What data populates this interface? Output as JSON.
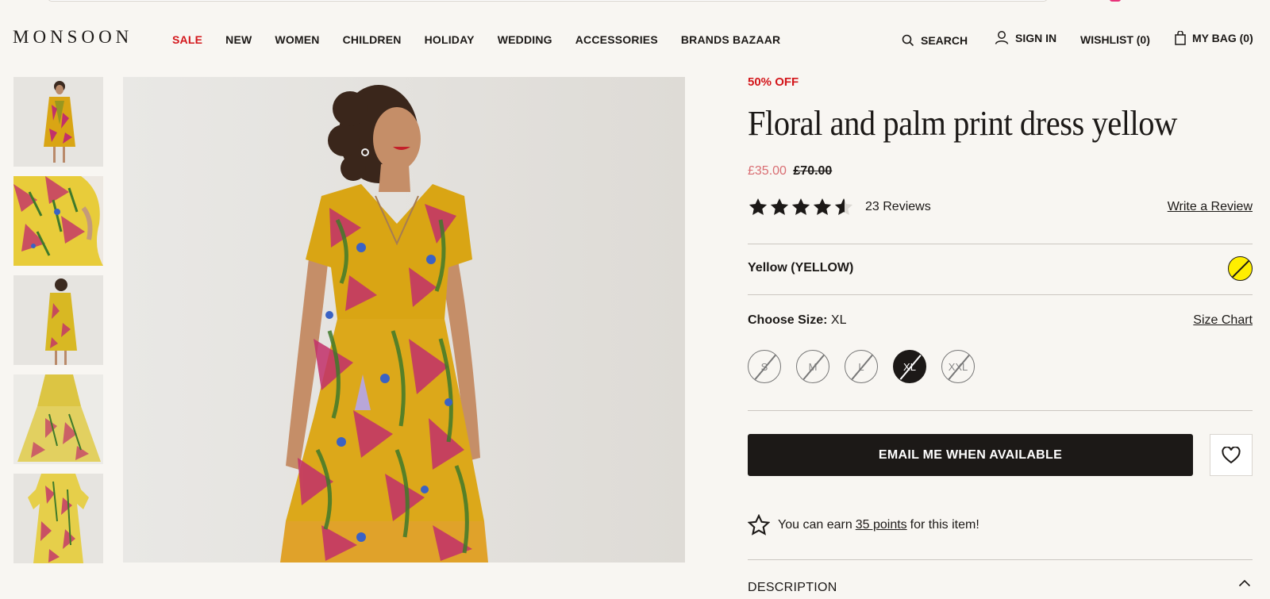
{
  "header": {
    "logo": "MONSOON",
    "nav": [
      "SALE",
      "NEW",
      "WOMEN",
      "CHILDREN",
      "HOLIDAY",
      "WEDDING",
      "ACCESSORIES",
      "BRANDS BAZAAR"
    ],
    "search_label": "SEARCH",
    "signin_label": "SIGN IN",
    "wishlist_label": "WISHLIST (0)",
    "bag_label": "MY BAG (0)"
  },
  "product": {
    "badge": "50% OFF",
    "title": "Floral and palm print dress yellow",
    "price_now": "£35.00",
    "price_was": "£70.00",
    "rating": 4.5,
    "reviews_count": "23 Reviews",
    "write_review": "Write a Review",
    "colour": "Yellow (YELLOW)",
    "size_label": "Choose Size:",
    "size_selected": "XL",
    "size_chart": "Size Chart",
    "sizes": [
      "S",
      "M",
      "L",
      "XL",
      "XXL"
    ],
    "email_button": "EMAIL ME WHEN AVAILABLE",
    "points_pre": "You can earn",
    "points_value": "35 points",
    "points_post": "for this item!",
    "description_heading": "DESCRIPTION"
  },
  "colors": {
    "sale_red": "#d3161b",
    "price_now": "#d96e73",
    "dark": "#1c1917",
    "swatch_yellow": "#ffee00"
  }
}
